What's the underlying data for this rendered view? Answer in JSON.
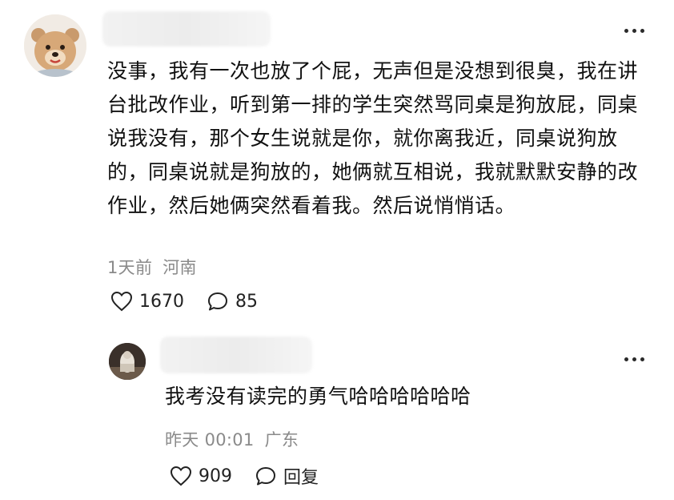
{
  "comment": {
    "text": "没事，我有一次也放了个屁，无声但是没想到很臭，我在讲台批改作业，听到第一排的学生突然骂同桌是狗放屁，同桌说我没有，那个女生说就是你，就你离我近，同桌说狗放的，同桌说就是狗放的，她俩就互相说，我就默默安静的改作业，然后她俩突然看着我。然后说悄悄话。",
    "time": "1天前",
    "location": "河南",
    "likes": "1670",
    "replies": "85",
    "avatar_icon": "bear-mascot-avatar",
    "more_icon": "more-dots-icon"
  },
  "reply": {
    "text": "我考没有读完的勇气哈哈哈哈哈哈",
    "time": "昨天 00:01",
    "location": "广东",
    "likes": "909",
    "reply_label": "回复",
    "avatar_icon": "user-avatar",
    "more_icon": "more-dots-icon"
  },
  "colors": {
    "text_primary": "#111111",
    "text_meta": "#8a8a8a",
    "background": "#ffffff"
  }
}
